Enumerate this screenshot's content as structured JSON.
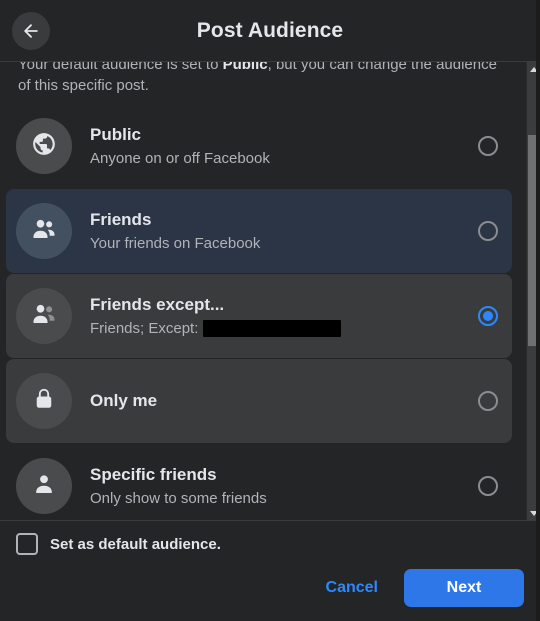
{
  "header": {
    "title": "Post Audience",
    "back_icon": "arrow-left-icon"
  },
  "intro": {
    "prefix": "Your default audience is set to ",
    "bold": "Public",
    "suffix": ", but you can change the audience of this specific post."
  },
  "options": [
    {
      "id": "public",
      "icon": "globe-icon",
      "title": "Public",
      "subtitle": "Anyone on or off Facebook",
      "selected": false,
      "state": "normal",
      "redacted": false
    },
    {
      "id": "friends",
      "icon": "two-people-icon",
      "title": "Friends",
      "subtitle": "Your friends on Facebook",
      "selected": false,
      "state": "hovered",
      "redacted": false
    },
    {
      "id": "friends-except",
      "icon": "people-except-icon",
      "title": "Friends except...",
      "subtitle": "Friends; Except:",
      "selected": true,
      "state": "pressed",
      "redacted": true
    },
    {
      "id": "only-me",
      "icon": "lock-icon",
      "title": "Only me",
      "subtitle": "",
      "selected": false,
      "state": "pressed",
      "redacted": false
    },
    {
      "id": "specific-friends",
      "icon": "person-icon",
      "title": "Specific friends",
      "subtitle": "Only show to some friends",
      "selected": false,
      "state": "normal",
      "redacted": false
    }
  ],
  "scrollbar": {
    "up_arrow_icon": "triangle-up-icon",
    "down_arrow_icon": "triangle-down-icon",
    "thumb_top_pct": 16,
    "thumb_height_pct": 46
  },
  "footer": {
    "checkbox_label": "Set as default audience.",
    "checkbox_checked": false,
    "cancel_label": "Cancel",
    "next_label": "Next"
  },
  "colors": {
    "accent": "#2d88ff",
    "primary_button": "#2d77e8",
    "surface": "#242526",
    "row_hover": "#2b3545",
    "row_pressed": "#3a3b3c",
    "icon_circle": "#4a4b4c",
    "text_primary": "#e4e6eb",
    "text_secondary": "#b0b3b8"
  }
}
